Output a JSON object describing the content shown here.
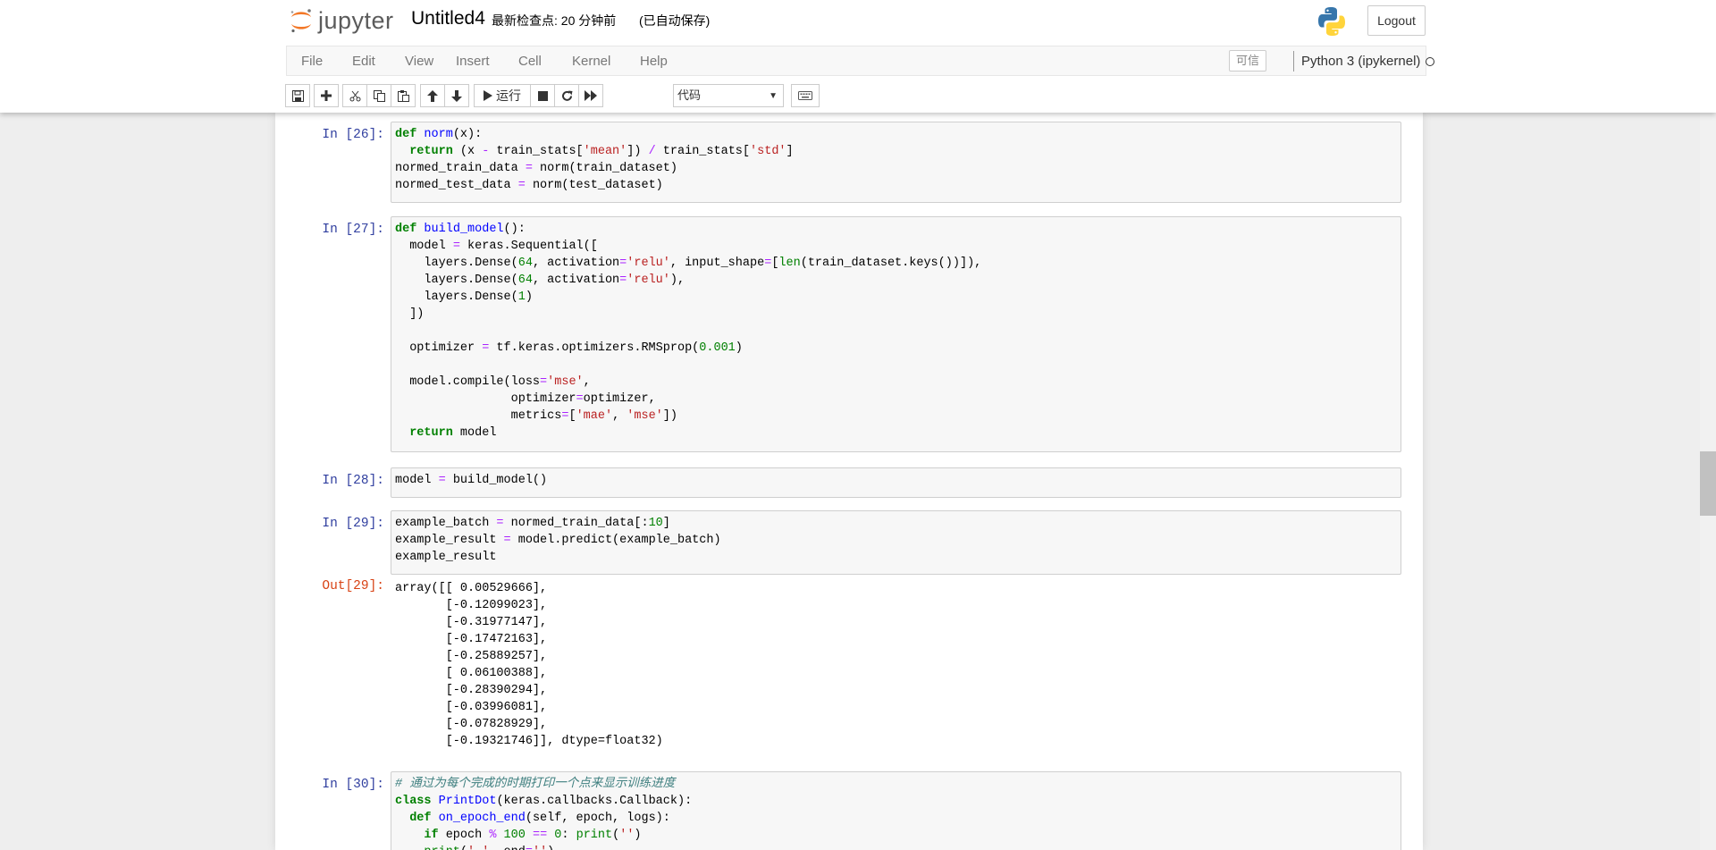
{
  "app": {
    "logo_text": "jupyter",
    "notebook_name": "Untitled4",
    "checkpoint": "最新检查点: 20 分钟前",
    "autosave": "(已自动保存)",
    "logout_label": "Logout"
  },
  "menubar": {
    "items": [
      "File",
      "Edit",
      "View",
      "Insert",
      "Cell",
      "Kernel",
      "Help"
    ],
    "trusted_label": "可信",
    "kernel_name": "Python 3 (ipykernel)"
  },
  "toolbar": {
    "run_label": "运行",
    "cell_type": "代码",
    "cell_type_options": [
      "代码"
    ]
  },
  "cells": [
    {
      "prompt": "In  [26]:",
      "lines": [
        "def norm(x):",
        "  return (x - train_stats['mean']) / train_stats['std']",
        "normed_train_data = norm(train_dataset)",
        "normed_test_data = norm(test_dataset)"
      ]
    },
    {
      "prompt": "In  [27]:",
      "lines": [
        "def build_model():",
        "  model = keras.Sequential([",
        "    layers.Dense(64, activation='relu', input_shape=[len(train_dataset.keys())]),",
        "    layers.Dense(64, activation='relu'),",
        "    layers.Dense(1)",
        "  ])",
        "",
        "  optimizer = tf.keras.optimizers.RMSprop(0.001)",
        "",
        "  model.compile(loss='mse',",
        "                optimizer=optimizer,",
        "                metrics=['mae', 'mse'])",
        "  return model"
      ]
    },
    {
      "prompt": "In  [28]:",
      "lines": [
        "model = build_model()"
      ]
    },
    {
      "prompt": "In  [29]:",
      "lines": [
        "example_batch = normed_train_data[:10]",
        "example_result = model.predict(example_batch)",
        "example_result"
      ],
      "out_prompt": "Out[29]:",
      "output": [
        "array([[ 0.00529666],",
        "       [-0.12099023],",
        "       [-0.31977147],",
        "       [-0.17472163],",
        "       [-0.25889257],",
        "       [ 0.06100388],",
        "       [-0.28390294],",
        "       [-0.03996081],",
        "       [-0.07828929],",
        "       [-0.19321746]], dtype=float32)"
      ]
    },
    {
      "prompt": "In  [30]:",
      "lines": [
        "# 通过为每个完成的时期打印一个点来显示训练进度",
        "class PrintDot(keras.callbacks.Callback):",
        "  def on_epoch_end(self, epoch, logs):",
        "    if epoch % 100 == 0: print('')",
        "    print('.', end='')"
      ]
    }
  ]
}
